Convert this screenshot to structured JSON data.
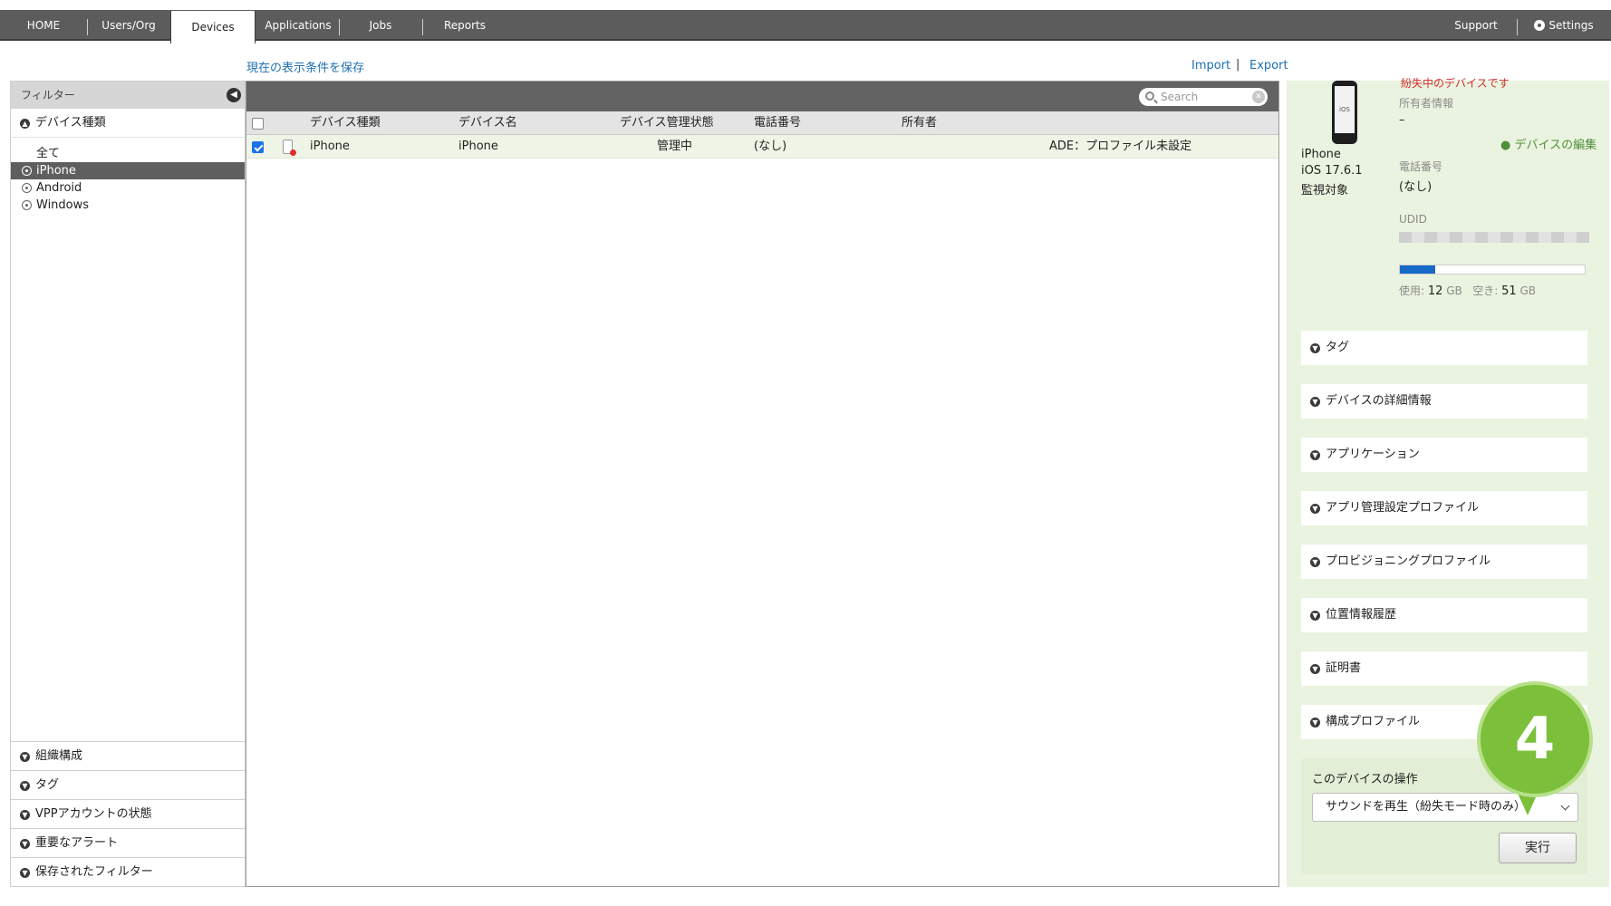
{
  "nav": {
    "tabs": [
      "HOME",
      "Users/Org",
      "Devices",
      "Applications",
      "Jobs",
      "Reports"
    ],
    "active": "Devices",
    "support": "Support",
    "settings": "Settings"
  },
  "save_view_link": "現在の表示条件を保存",
  "import_label": "Import",
  "export_label": "Export",
  "link_separator": "|",
  "filter": {
    "header": "フィルター",
    "device_type_title": "デバイス種類",
    "items": [
      "全て",
      "iPhone",
      "Android",
      "Windows"
    ],
    "selected": "iPhone",
    "bottom_sections": [
      "組織構成",
      "タグ",
      "VPPアカウントの状態",
      "重要なアラート",
      "保存されたフィルター"
    ]
  },
  "table": {
    "search_placeholder": "Search",
    "columns": [
      "デバイス種類",
      "デバイス名",
      "デバイス管理状態",
      "電話番号",
      "所有者"
    ],
    "rows": [
      {
        "type": "iPhone",
        "name": "iPhone",
        "status": "管理中",
        "phone": "(なし)",
        "owner": "",
        "note": "ADE：プロファイル未設定"
      }
    ]
  },
  "detail": {
    "top_cut_text": "紛失中のデバイスです",
    "phone_screen_text": "iOS",
    "device_name": "iPhone",
    "os": "iOS 17.6.1",
    "supervised": "監視対象",
    "owner_label": "所有者情報",
    "owner_value": "–",
    "edit_link": "デバイスの編集",
    "phone_label": "電話番号",
    "phone_value": "(なし)",
    "udid_label": "UDID",
    "storage": {
      "used_label": "使用:",
      "used_value": "12",
      "free_label": "空き:",
      "free_value": "51",
      "unit": "GB",
      "used_fraction": 0.19
    },
    "sections": [
      "タグ",
      "デバイスの詳細情報",
      "アプリケーション",
      "アプリ管理設定プロファイル",
      "プロビジョニングプロファイル",
      "位置情報履歴",
      "証明書",
      "構成プロファイル"
    ],
    "ops_title": "このデバイスの操作",
    "ops_selected": "サウンドを再生（紛失モード時のみ）",
    "run_button": "実行"
  },
  "callout_number": "4",
  "colors": {
    "nav_bg": "#5c5c5c",
    "selected_row": "#eef5e6",
    "detail_bg": "#eaf3df",
    "callout": "#7cbf3a",
    "storage_used": "#1669c7"
  }
}
